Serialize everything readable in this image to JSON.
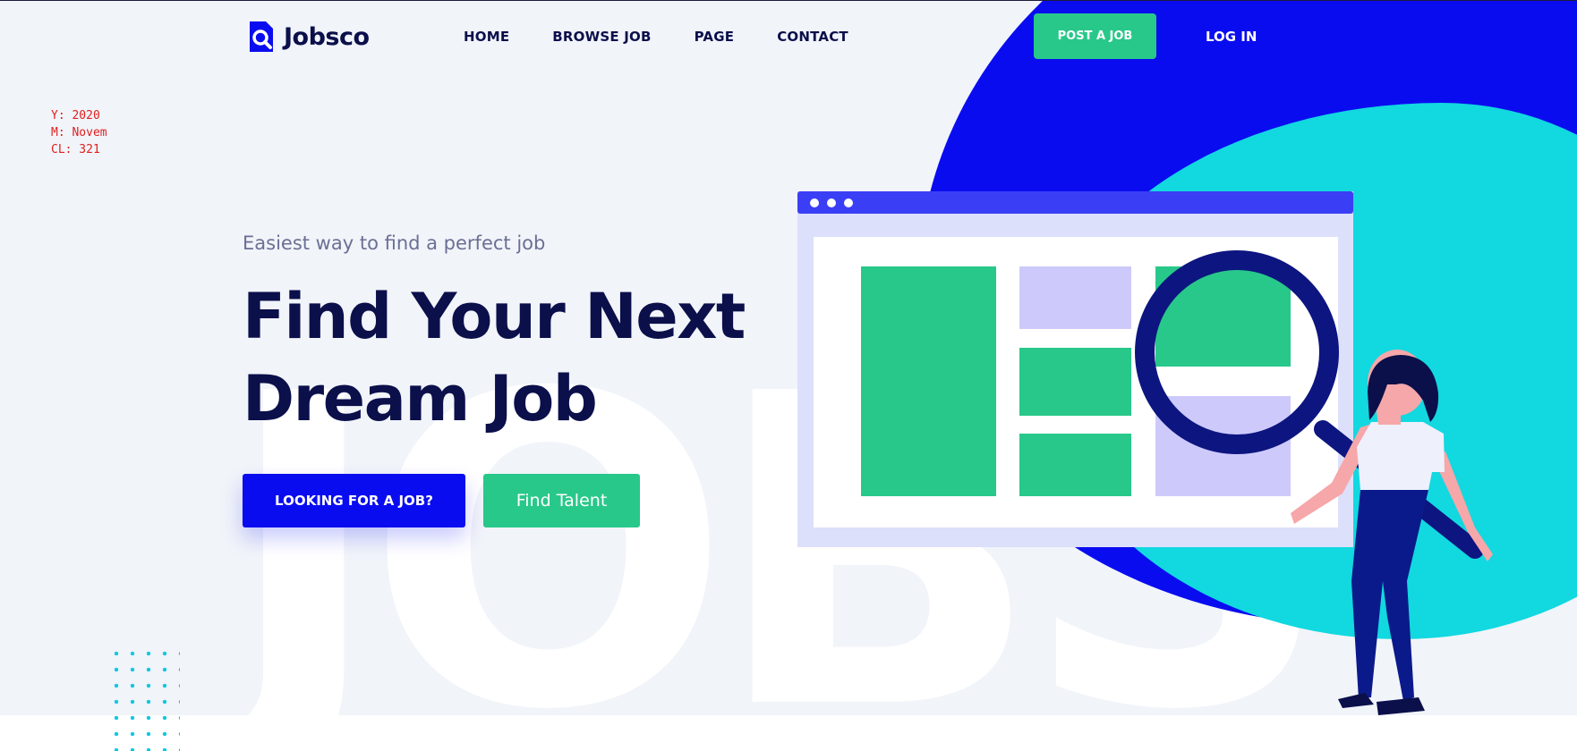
{
  "brand": {
    "name": "Jobsco"
  },
  "nav": {
    "items": [
      "HOME",
      "BROWSE JOB",
      "PAGE",
      "CONTACT"
    ],
    "post_job": "POST A JOB",
    "login": "LOG IN"
  },
  "debug": {
    "y": "Y: 2020",
    "m": "M: Novem",
    "cl": "CL: 321"
  },
  "hero": {
    "tagline": "Easiest way to find a perfect job",
    "headline_line1": "Find Your Next",
    "headline_line2": "Dream Job",
    "cta_primary": "LOOKING FOR A JOB?",
    "cta_secondary": "Find Talent",
    "watermark": "JOBS"
  },
  "colors": {
    "navy": "#0b0f4a",
    "blue": "#0a0cf0",
    "green": "#28c88a",
    "cyan": "#12d8e0",
    "lavender": "#cdcafb",
    "background": "#f1f4f9"
  },
  "icons": [
    "logo-search-icon",
    "magnifier-icon",
    "window-dots-icon"
  ]
}
